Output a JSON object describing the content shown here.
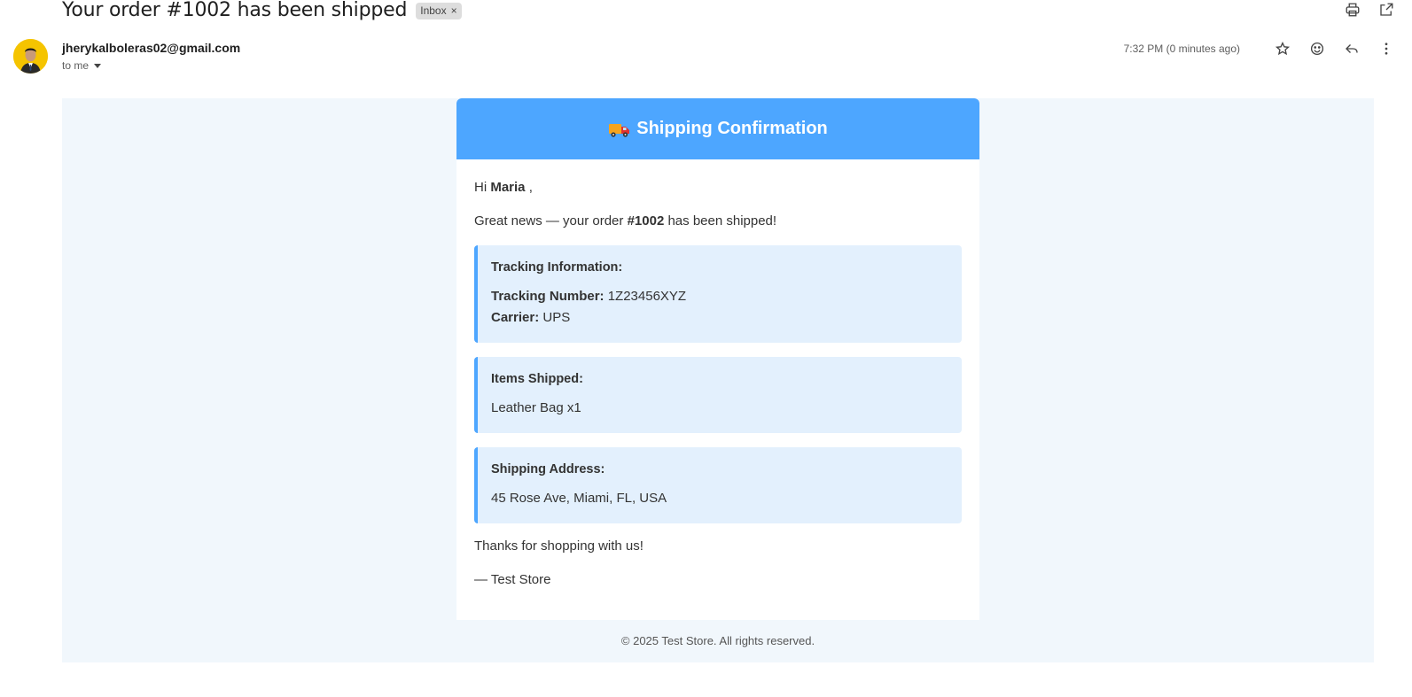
{
  "header": {
    "subject": "Your order #1002 has been shipped",
    "label": "Inbox",
    "label_close": "×"
  },
  "sender": {
    "email": "jherykalboleras02@gmail.com",
    "to": "to me",
    "timestamp": "7:32 PM (0 minutes ago)"
  },
  "icons": {
    "print": "print-icon",
    "open_new": "open-in-new-window-icon",
    "star": "star-icon",
    "emoji": "emoji-icon",
    "reply": "reply-icon",
    "more": "more-vert-icon"
  },
  "email": {
    "header_title": "Shipping Confirmation",
    "greeting_prefix": "Hi",
    "customer_name": "Maria",
    "greeting_suffix": ",",
    "intro_prefix": "Great news — your order",
    "order_number": "#1002",
    "intro_suffix": "has been shipped!",
    "tracking": {
      "title": "Tracking Information:",
      "number_label": "Tracking Number:",
      "number_value": "1Z23456XYZ",
      "carrier_label": "Carrier:",
      "carrier_value": "UPS"
    },
    "items": {
      "title": "Items Shipped:",
      "value": "Leather Bag x1"
    },
    "address": {
      "title": "Shipping Address:",
      "value": "45 Rose Ave, Miami, FL, USA"
    },
    "thanks": "Thanks for shopping with us!",
    "signature": "— Test Store",
    "footer": "© 2025 Test Store. All rights reserved."
  },
  "colors": {
    "accent": "#4da6ff",
    "box_bg": "#e3f0fd",
    "email_bg": "#f1f7fc",
    "avatar_bg": "#f5c400"
  }
}
